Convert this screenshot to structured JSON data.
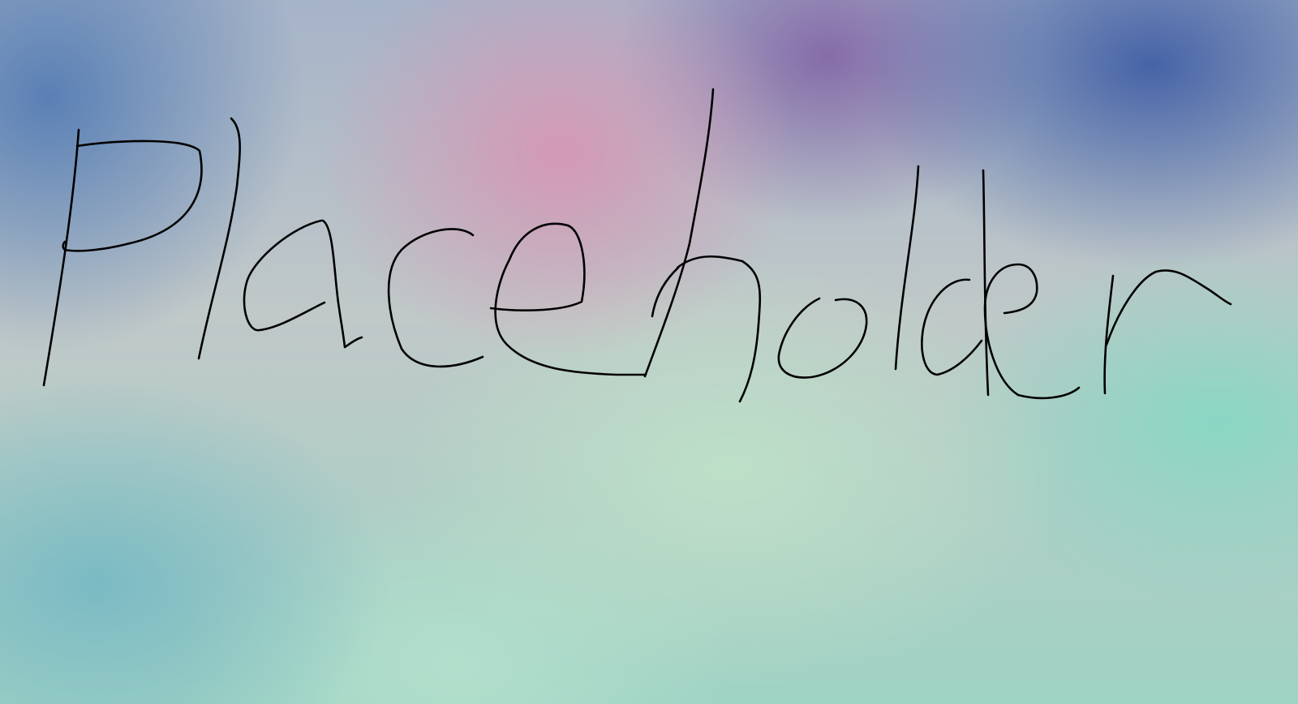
{
  "image": {
    "handwritten_text": "Placeholder",
    "ink_color": "#000000",
    "background_colors": [
      "#5e86b8",
      "#d39bb6",
      "#8a6fa8",
      "#4a6aaa",
      "#bfe0c8",
      "#8fd7c4",
      "#79b7c4"
    ]
  }
}
